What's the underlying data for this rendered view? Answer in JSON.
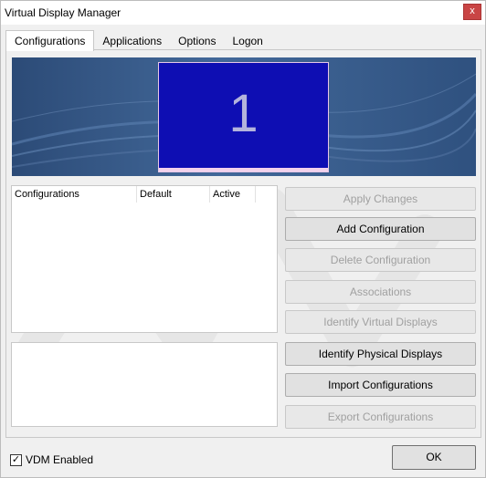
{
  "window": {
    "title": "Virtual Display Manager",
    "close_label": "x"
  },
  "tabs": [
    {
      "label": "Configurations",
      "active": true
    },
    {
      "label": "Applications"
    },
    {
      "label": "Options"
    },
    {
      "label": "Logon"
    }
  ],
  "monitor": {
    "number": "1"
  },
  "list": {
    "columns": [
      "Configurations",
      "Default",
      "Active"
    ]
  },
  "buttons": [
    {
      "label": "Apply Changes",
      "enabled": false
    },
    {
      "label": "Add Configuration",
      "enabled": true
    },
    {
      "label": "Delete Configuration",
      "enabled": false
    },
    {
      "label": "Associations",
      "enabled": false
    },
    {
      "label": "Identify Virtual Displays",
      "enabled": false
    },
    {
      "label": "Identify Physical Displays",
      "enabled": true
    },
    {
      "label": "Import Configurations",
      "enabled": true
    },
    {
      "label": "Export Configurations",
      "enabled": false
    }
  ],
  "footer": {
    "vdm_label": "VDM Enabled",
    "vdm_checked": true,
    "check_mark": "✓",
    "ok_label": "OK"
  }
}
